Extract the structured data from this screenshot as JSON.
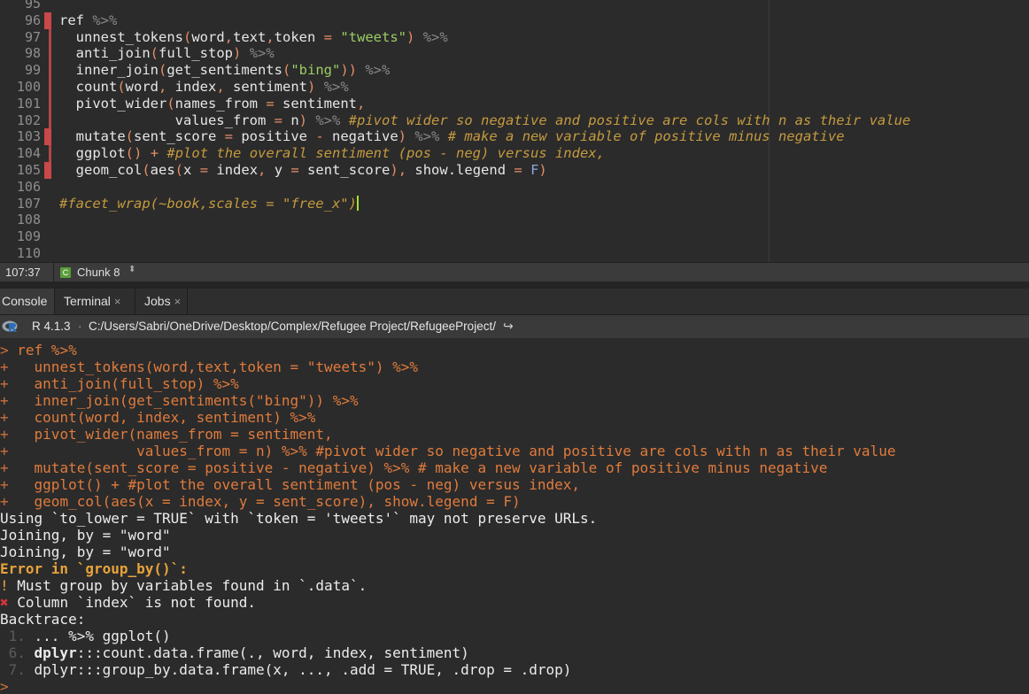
{
  "editor": {
    "lines": [
      {
        "n": "95",
        "code": ""
      },
      {
        "n": "96",
        "code": "ref %>%"
      },
      {
        "n": "97",
        "code": "  unnest_tokens(word,text,token = \"tweets\") %>%"
      },
      {
        "n": "98",
        "code": "  anti_join(full_stop) %>%"
      },
      {
        "n": "99",
        "code": "  inner_join(get_sentiments(\"bing\")) %>%"
      },
      {
        "n": "100",
        "code": "  count(word, index, sentiment) %>%"
      },
      {
        "n": "101",
        "code": "  pivot_wider(names_from = sentiment,"
      },
      {
        "n": "102",
        "code": "              values_from = n) %>% #pivot wider so negative and positive are cols with n as their value"
      },
      {
        "n": "103",
        "code": "  mutate(sent_score = positive - negative) %>% # make a new variable of positive minus negative"
      },
      {
        "n": "104",
        "code": "  ggplot() + #plot the overall sentiment (pos - neg) versus index,"
      },
      {
        "n": "105",
        "code": "  geom_col(aes(x = index, y = sent_score), show.legend = F)"
      },
      {
        "n": "106",
        "code": ""
      },
      {
        "n": "107",
        "code": "#facet_wrap(~book,scales = \"free_x\")"
      },
      {
        "n": "108",
        "code": ""
      },
      {
        "n": "109",
        "code": ""
      },
      {
        "n": "110",
        "code": ""
      }
    ]
  },
  "status_bar": {
    "cursor_position": "107:37",
    "chunk_icon": "C",
    "chunk_label": "Chunk 8",
    "chunk_nav_icon": "updown-arrows-icon"
  },
  "tabs": [
    {
      "label": "Console",
      "closable": false,
      "active": true
    },
    {
      "label": "Terminal",
      "closable": true,
      "active": false
    },
    {
      "label": "Jobs",
      "closable": true,
      "active": false
    }
  ],
  "console_header": {
    "r_version": "R 4.1.3",
    "separator": "·",
    "working_dir": "C:/Users/Sabri/OneDrive/Desktop/Complex/Refugee Project/RefugeeProject/",
    "go_icon": "↪"
  },
  "console": {
    "echo": [
      {
        "p": ">",
        "t": " ref %>%"
      },
      {
        "p": "+",
        "t": "   unnest_tokens(word,text,token = \"tweets\") %>%"
      },
      {
        "p": "+",
        "t": "   anti_join(full_stop) %>%"
      },
      {
        "p": "+",
        "t": "   inner_join(get_sentiments(\"bing\")) %>%"
      },
      {
        "p": "+",
        "t": "   count(word, index, sentiment) %>%"
      },
      {
        "p": "+",
        "t": "   pivot_wider(names_from = sentiment,"
      },
      {
        "p": "+",
        "t": "               values_from = n) %>% #pivot wider so negative and positive are cols with n as their value"
      },
      {
        "p": "+",
        "t": "   mutate(sent_score = positive - negative) %>% # make a new variable of positive minus negative"
      },
      {
        "p": "+",
        "t": "   ggplot() + #plot the overall sentiment (pos - neg) versus index,"
      },
      {
        "p": "+",
        "t": "   geom_col(aes(x = index, y = sent_score), show.legend = F)"
      }
    ],
    "messages": [
      "Using `to_lower = TRUE` with `token = 'tweets'` may not preserve URLs.",
      "Joining, by = \"word\"",
      "Joining, by = \"word\""
    ],
    "error_head": "Error in `group_by()`:",
    "error_lines": [
      {
        "bullet": "!",
        "text": " Must group by variables found in `.data`."
      },
      {
        "bullet": "✖",
        "text": " Column `index` is not found."
      }
    ],
    "backtrace_label": "Backtrace:",
    "backtrace": [
      {
        "num": "1. ",
        "pre": "",
        "bold": "",
        "text": "... %>% ggplot()"
      },
      {
        "num": "6. ",
        "pre": "",
        "bold": "dplyr",
        "text": ":::count.data.frame(., word, index, sentiment)"
      },
      {
        "num": "7. ",
        "pre": "",
        "bold": "",
        "text": "dplyr:::group_by.data.frame(x, ..., .add = TRUE, .drop = .drop)"
      }
    ],
    "final_prompt": ">"
  }
}
